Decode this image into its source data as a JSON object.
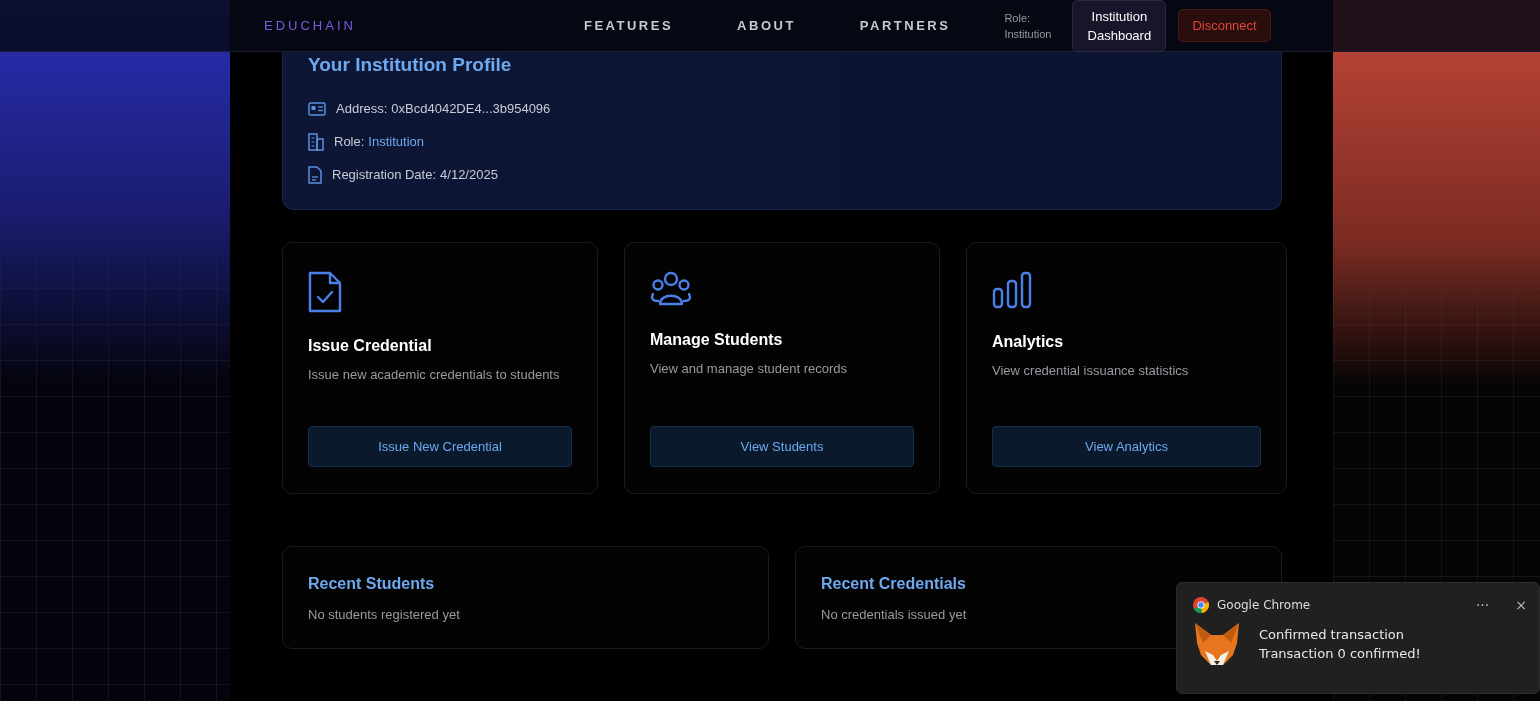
{
  "header": {
    "logo": "EDUCHAIN",
    "nav": [
      {
        "label": "FEATURES"
      },
      {
        "label": "ABOUT"
      },
      {
        "label": "PARTNERS"
      }
    ],
    "role_label": "Role:",
    "role_value": "Institution",
    "dashboard_button": "Institution Dashboard",
    "disconnect_button": "Disconnect"
  },
  "profile": {
    "title": "Your Institution Profile",
    "rows": [
      {
        "kind": "id",
        "label": "Address:",
        "value": "0xBcd4042DE4...3b954096",
        "accent": false
      },
      {
        "kind": "building",
        "label": "Role:",
        "value": "Institution",
        "accent": true
      },
      {
        "kind": "document",
        "label": "Registration Date:",
        "value": "4/12/2025",
        "accent": false
      }
    ]
  },
  "actions": [
    {
      "kind": "credential",
      "title": "Issue Credential",
      "description": "Issue new academic credentials to students",
      "button": "Issue New Credential"
    },
    {
      "kind": "students",
      "title": "Manage Students",
      "description": "View and manage student records",
      "button": "View Students"
    },
    {
      "kind": "analytics",
      "title": "Analytics",
      "description": "View credential issuance statistics",
      "button": "View Analytics"
    }
  ],
  "recent": [
    {
      "title": "Recent Students",
      "empty": "No students registered yet"
    },
    {
      "title": "Recent Credentials",
      "empty": "No credentials issued yet"
    }
  ],
  "notification": {
    "app": "Google Chrome",
    "more": "···",
    "close": "×",
    "title": "Confirmed transaction",
    "message": "Transaction 0 confirmed!"
  }
}
